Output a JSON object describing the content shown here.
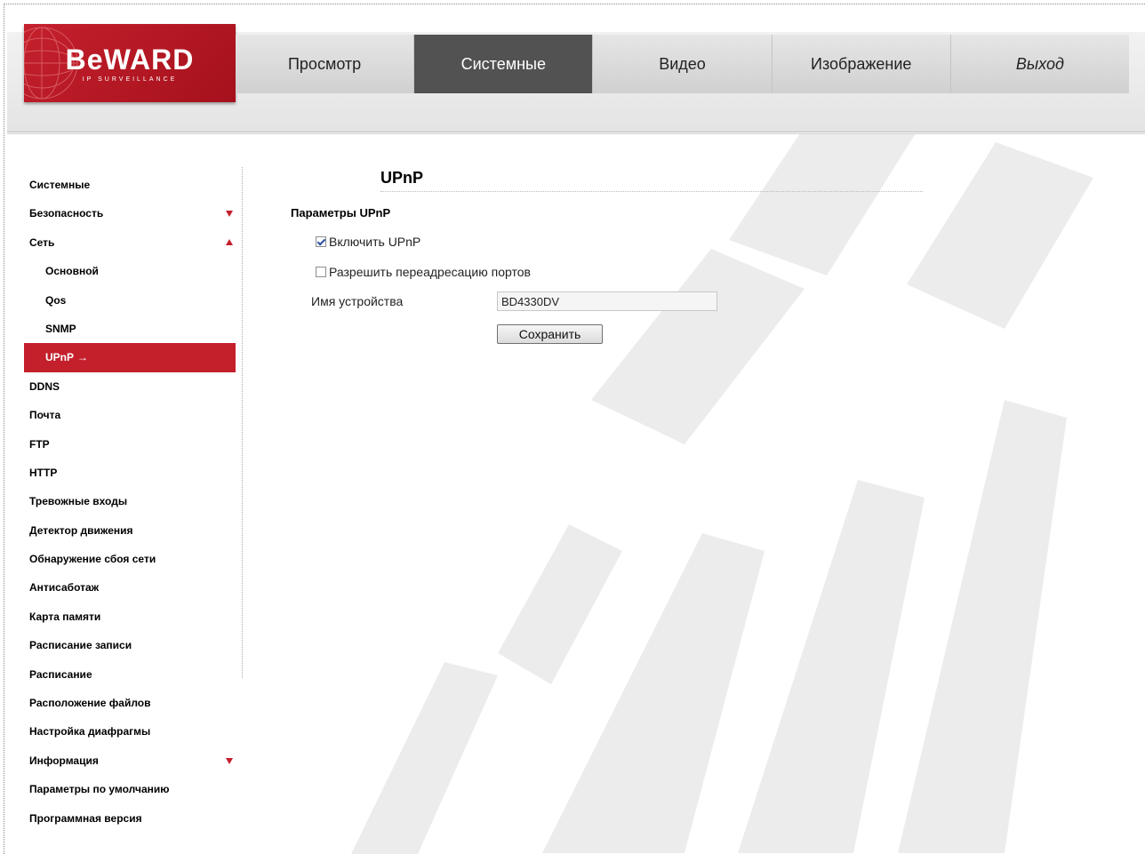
{
  "brand": {
    "logo_text": "BeWARD",
    "logo_sub": "IP SURVEILLANCE",
    "accent_color": "#c4202c"
  },
  "nav": {
    "tabs": [
      {
        "label": "Просмотр",
        "active": false
      },
      {
        "label": "Системные",
        "active": true
      },
      {
        "label": "Видео",
        "active": false
      },
      {
        "label": "Изображение",
        "active": false
      },
      {
        "label": "Выход",
        "active": false
      }
    ]
  },
  "sidebar": {
    "items": [
      {
        "label": "Системные"
      },
      {
        "label": "Безопасность",
        "indicator": "collapsed"
      },
      {
        "label": "Сеть",
        "indicator": "expanded"
      },
      {
        "label": "Основной",
        "sub": true
      },
      {
        "label": "Qos",
        "sub": true
      },
      {
        "label": "SNMP",
        "sub": true
      },
      {
        "label": "UPnP",
        "sub": true,
        "active": true,
        "arrow": "→"
      },
      {
        "label": "DDNS"
      },
      {
        "label": "Почта"
      },
      {
        "label": "FTP"
      },
      {
        "label": "HTTP"
      },
      {
        "label": "Тревожные входы"
      },
      {
        "label": "Детектор движения"
      },
      {
        "label": "Обнаружение сбоя сети"
      },
      {
        "label": "Антисаботаж"
      },
      {
        "label": "Карта памяти"
      },
      {
        "label": "Расписание записи"
      },
      {
        "label": "Расписание"
      },
      {
        "label": "Расположение файлов"
      },
      {
        "label": "Настройка диафрагмы"
      },
      {
        "label": "Информация",
        "indicator": "collapsed"
      },
      {
        "label": "Параметры по умолчанию"
      },
      {
        "label": "Программная версия"
      }
    ]
  },
  "main": {
    "title": "UPnP",
    "section_title": "Параметры UPnP",
    "enable_upnp": {
      "label": "Включить UPnP",
      "checked": true
    },
    "port_forwarding": {
      "label": "Разрешить переадресацию портов",
      "checked": false
    },
    "device_name_label": "Имя устройства",
    "device_name_value": "BD4330DV",
    "save_label": "Сохранить"
  }
}
